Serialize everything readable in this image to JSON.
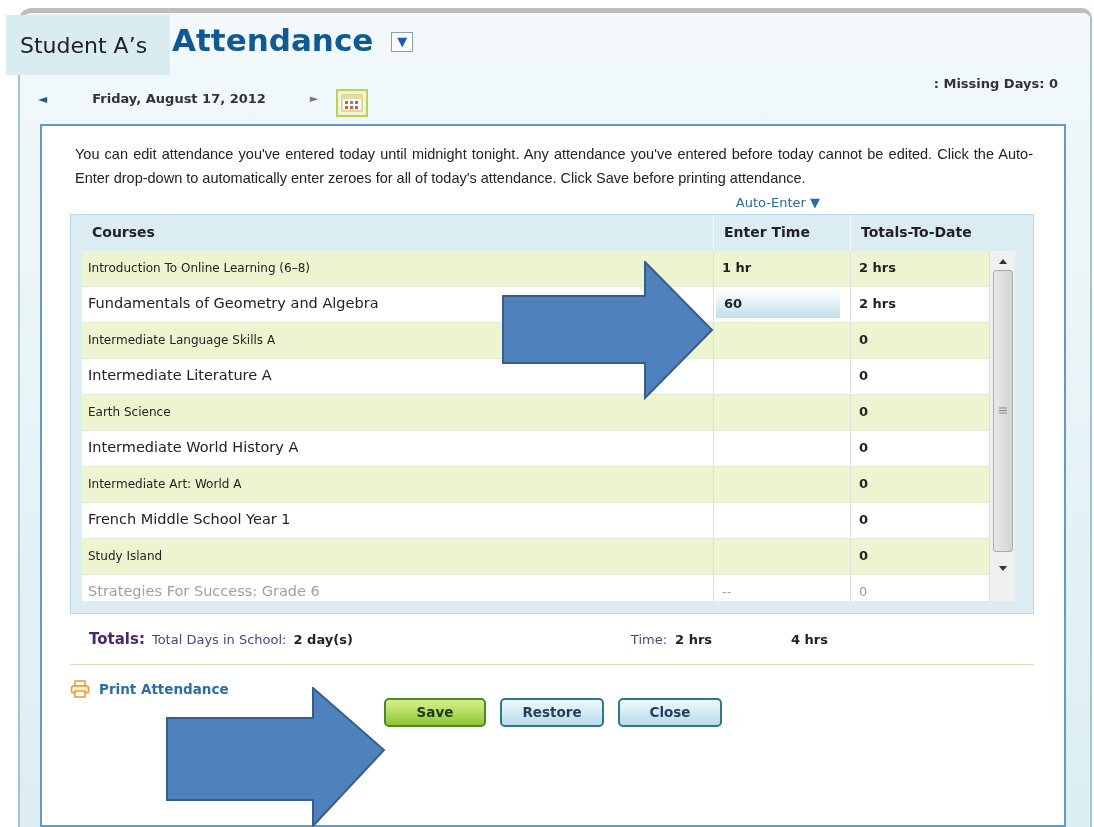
{
  "header": {
    "student_label": "Student A’s",
    "title": "Attendance",
    "title_menu": "▼"
  },
  "date_nav": {
    "prev": "◄",
    "date": "Friday, August 17, 2012",
    "next": "►"
  },
  "missing_days": ": Missing Days: 0",
  "instructions": "You can edit attendance you've entered today until midnight tonight. Any attendance you've entered before today cannot be edited. Click the Auto-Enter drop-down to automatically enter zeroes for all of today's attendance. Click Save before printing attendance.",
  "auto_enter": "Auto-Enter ▼",
  "table": {
    "columns": [
      "Courses",
      "Enter Time",
      "Totals-To-Date"
    ],
    "rows": [
      {
        "course": "Introduction To Online Learning (6–8)",
        "enter_time": "1 hr",
        "total": "2 hrs",
        "shaded": true,
        "editing": false,
        "disabled": false
      },
      {
        "course": "Fundamentals of Geometry and Algebra",
        "enter_time": "60",
        "total": "2 hrs",
        "shaded": false,
        "editing": true,
        "disabled": false
      },
      {
        "course": "Intermediate Language Skills A",
        "total": "0",
        "shaded": true,
        "editing": false,
        "disabled": false
      },
      {
        "course": "Intermediate Literature A",
        "total": "0",
        "shaded": false,
        "editing": false,
        "disabled": false
      },
      {
        "course": "Earth Science",
        "total": "0",
        "shaded": true,
        "editing": false,
        "disabled": false
      },
      {
        "course": "Intermediate World History A",
        "total": "0",
        "shaded": false,
        "editing": false,
        "disabled": false
      },
      {
        "course": "Intermediate Art: World A",
        "total": "0",
        "shaded": true,
        "editing": false,
        "disabled": false
      },
      {
        "course": "French Middle School Year 1",
        "total": "0",
        "shaded": false,
        "editing": false,
        "disabled": false
      },
      {
        "course": "Study Island",
        "total": "0",
        "shaded": true,
        "editing": false,
        "disabled": false
      },
      {
        "course": "Strategies For Success: Grade 6",
        "enter_time": "--",
        "total": "0",
        "shaded": false,
        "editing": false,
        "disabled": true
      }
    ]
  },
  "totals": {
    "label": "Totals:",
    "days_label": "Total Days in School:",
    "days_value": "2 day(s)",
    "time_label": "Time:",
    "time_value": "2 hrs",
    "total_value": "4 hrs"
  },
  "print_link": "Print Attendance",
  "buttons": [
    {
      "label": "Save",
      "primary": true
    },
    {
      "label": "Restore",
      "primary": false
    },
    {
      "label": "Close",
      "primary": false
    }
  ]
}
